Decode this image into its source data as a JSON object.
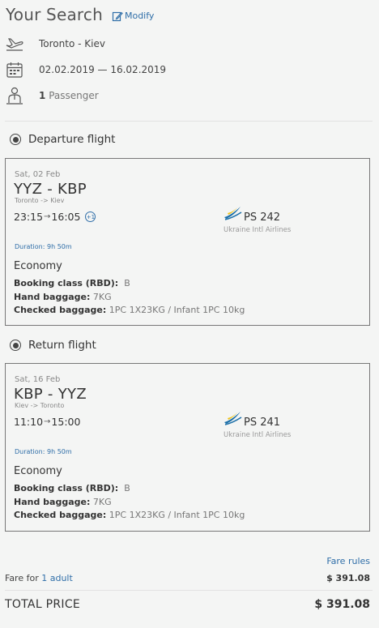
{
  "header": {
    "title": "Your Search",
    "modify_label": "Modify"
  },
  "summary": {
    "route": "Toronto - Kiev",
    "dates": "02.02.2019 — 16.02.2019",
    "passenger_count": "1",
    "passenger_label": "Passenger"
  },
  "departure": {
    "section_label": "Departure flight",
    "date": "Sat, 02 Feb",
    "route": "YYZ - KBP",
    "cities": "Toronto -> Kiev",
    "dep_time": "23:15",
    "arr_time": "16:05",
    "day_offset": "+1",
    "flight_no": "PS 242",
    "airline": "Ukraine Intl Airlines",
    "duration": "Duration: 9h 50m",
    "cabin": "Economy",
    "booking_class_label": "Booking class (RBD):",
    "booking_class_value": "B",
    "hand_baggage_label": "Hand baggage:",
    "hand_baggage_value": "7KG",
    "checked_baggage_label": "Checked baggage:",
    "checked_baggage_value": "1PC 1X23KG / Infant 1PC 10kg"
  },
  "return": {
    "section_label": "Return flight",
    "date": "Sat, 16 Feb",
    "route": "KBP - YYZ",
    "cities": "Kiev -> Toronto",
    "dep_time": "11:10",
    "arr_time": "15:00",
    "flight_no": "PS 241",
    "airline": "Ukraine Intl Airlines",
    "duration": "Duration: 9h 50m",
    "cabin": "Economy",
    "booking_class_label": "Booking class (RBD):",
    "booking_class_value": "B",
    "hand_baggage_label": "Hand baggage:",
    "hand_baggage_value": "7KG",
    "checked_baggage_label": "Checked baggage:",
    "checked_baggage_value": "1PC 1X23KG / Infant 1PC 10kg"
  },
  "fare": {
    "rules_label": "Fare rules",
    "fare_for_prefix": "Fare for",
    "adult_link": "1 adult",
    "fare_amount": "$ 391.08",
    "total_label": "TOTAL PRICE",
    "total_amount": "$ 391.08"
  },
  "colors": {
    "link": "#2f6ea8",
    "airline_logo_blue": "#1b6fa8",
    "airline_logo_yellow": "#f0c419"
  },
  "icons": [
    "edit-icon",
    "plane-icon",
    "calendar-icon",
    "passenger-icon",
    "airline-logo-icon"
  ]
}
